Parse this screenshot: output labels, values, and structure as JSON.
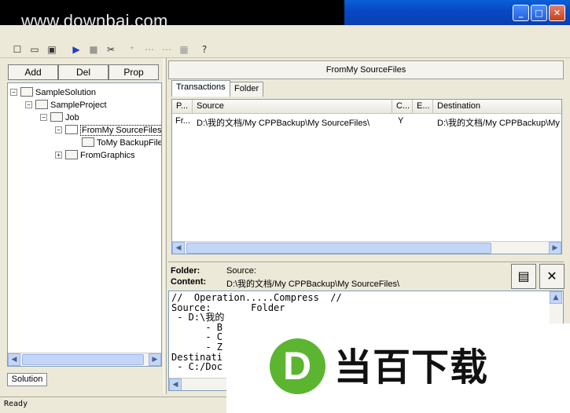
{
  "watermark": "www.downbai.com",
  "window_controls": {
    "minimize": "_",
    "maximize": "□",
    "close": "✕"
  },
  "toolbar_icons": [
    "new-icon",
    "open-icon",
    "save-icon",
    "run-icon",
    "stop-icon",
    "cut-icon",
    "add-folder-icon",
    "move-icon",
    "grid-icon",
    "help-icon"
  ],
  "left_panel": {
    "buttons": {
      "add": "Add",
      "del": "Del",
      "prop": "Prop"
    },
    "tree": [
      {
        "label": "SampleSolution",
        "level": 0,
        "expander": "−"
      },
      {
        "label": "SampleProject",
        "level": 1,
        "expander": "−"
      },
      {
        "label": "Job",
        "level": 2,
        "expander": "−"
      },
      {
        "label": "FromMy SourceFiles",
        "level": 3,
        "expander": "−",
        "selected": true
      },
      {
        "label": "ToMy BackupFiles",
        "level": 4,
        "expander": ""
      },
      {
        "label": "FromGraphics",
        "level": 3,
        "expander": "+"
      }
    ],
    "bottom_tab": "Solution"
  },
  "right_panel": {
    "header": "FromMy SourceFiles",
    "tabs": [
      "Transactions",
      "Folder"
    ],
    "columns": [
      "P...",
      "Source",
      "C...",
      "E...",
      "Destination"
    ],
    "rows": [
      {
        "p": "Fr...",
        "source": "D:\\我的文档/My CPPBackup\\My SourceFiles\\",
        "c": "Y",
        "e": "",
        "destination": "D:\\我的文档/My CPPBackup\\My SourceFiles\\"
      }
    ],
    "detail": {
      "folder_label": "Folder:",
      "folder_value": "Source:",
      "content_label": "Content:",
      "content_value": "D:\\我的文档/My CPPBackup\\My SourceFiles\\"
    },
    "log_lines": [
      "//  Operation.....Compress  //",
      "Source:       Folder",
      " - D:\\我的",
      "      - B",
      "      - C",
      "      - Z",
      "Destinati",
      " - C:/Doc"
    ]
  },
  "status": "Ready",
  "logo": {
    "letter": "D",
    "text": "当百下载",
    "color": "#5cb531"
  }
}
